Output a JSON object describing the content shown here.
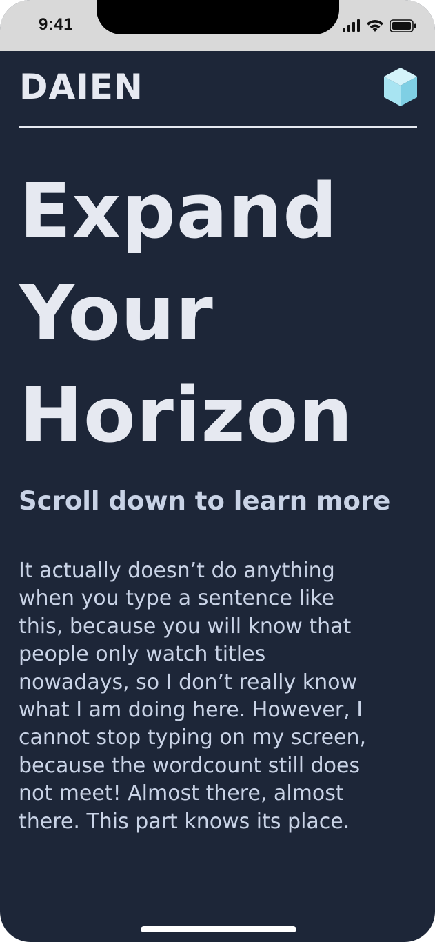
{
  "status_bar": {
    "time": "9:41",
    "icons": [
      "signal-icon",
      "wifi-icon",
      "battery-icon"
    ]
  },
  "header": {
    "brand": "DAIEN",
    "logo_icon": "cube-icon"
  },
  "hero": {
    "headline_lines": [
      "Expand",
      "Your",
      "Horizon"
    ],
    "subheading": "Scroll down to learn more",
    "body_lines": [
      "It actually doesn’t do anything",
      "when you type a sentence like",
      "this, because you will know that",
      "people only watch titles",
      "nowadays, so I don’t really know",
      "what I am doing here. However, I",
      "cannot stop typing on my screen,",
      "because the wordcount still does",
      "not meet! Almost there, almost",
      "there. This part knows its place."
    ]
  },
  "colors": {
    "background": "#1d2638",
    "status_bar": "#d9d9d9",
    "text_primary": "#e6e9f1",
    "text_secondary": "#c9d3e6",
    "logo_accent": "#a8e4f2"
  }
}
